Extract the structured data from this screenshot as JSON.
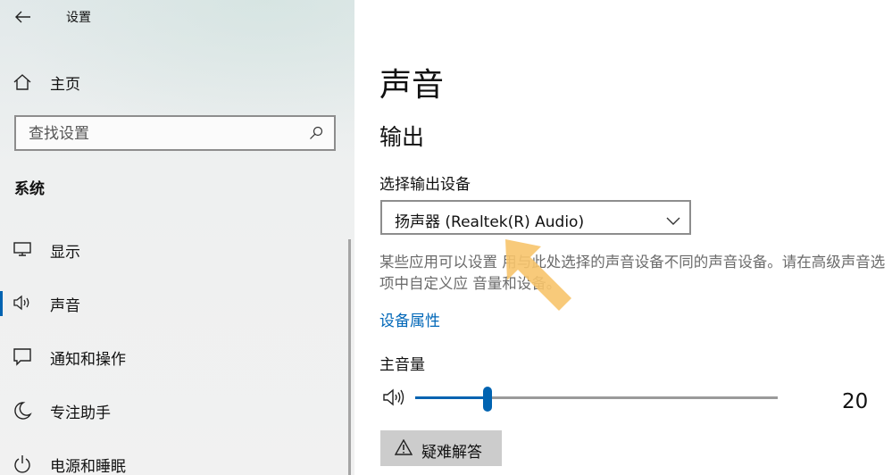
{
  "window": {
    "title": "设置"
  },
  "sidebar": {
    "home_label": "主页",
    "search": {
      "placeholder": "查找设置",
      "value": ""
    },
    "section_heading": "系统",
    "items": [
      {
        "label": "显示",
        "icon": "monitor-icon"
      },
      {
        "label": "声音",
        "icon": "speaker-icon",
        "active": true
      },
      {
        "label": "通知和操作",
        "icon": "notification-icon"
      },
      {
        "label": "专注助手",
        "icon": "moon-icon"
      },
      {
        "label": "电源和睡眠",
        "icon": "power-icon"
      }
    ]
  },
  "main": {
    "page_title": "声音",
    "output_section": {
      "title": "输出",
      "device_label": "选择输出设备",
      "device_selected": "扬声器 (Realtek(R) Audio)",
      "description": "某些应用可以设置 用与此处选择的声音设备不同的声音设备。请在高级声音选项中自定义应 音量和设备。",
      "device_properties_link": "设备属性",
      "master_volume_label": "主音量",
      "master_volume_value": "20",
      "master_volume_level": 0.2,
      "troubleshoot_label": "疑难解答"
    }
  },
  "colors": {
    "accent": "#0063b1",
    "link": "#0067b8",
    "annotation_arrow": "#f7c46c"
  }
}
